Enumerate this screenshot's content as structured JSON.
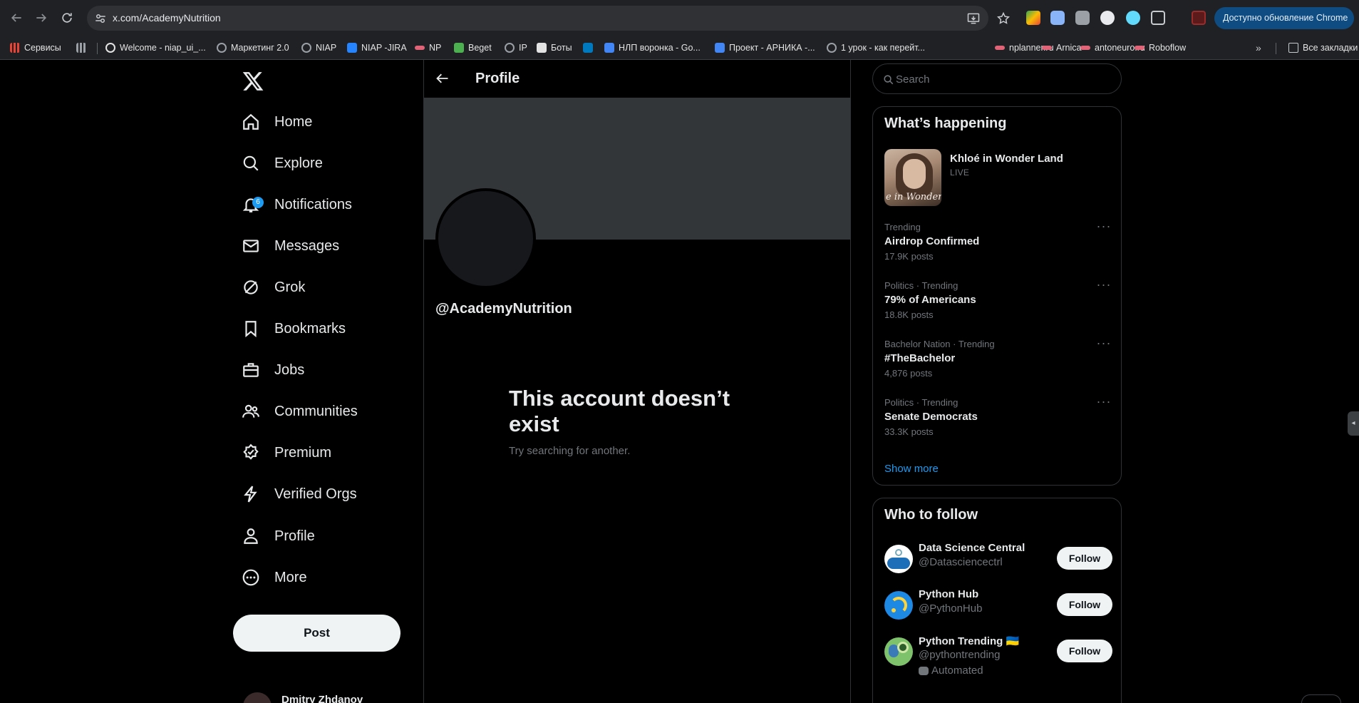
{
  "browser": {
    "url": "x.com/AcademyNutrition",
    "update_label": "Доступно обновление Chrome",
    "bookmarks": [
      {
        "label": "Сервисы",
        "icon": "apps-grid-icon",
        "color": "#ea4335"
      },
      {
        "label": "",
        "icon": "grid-icon",
        "color": "#9aa0a6"
      },
      {
        "label": "Welcome - niap_ui_...",
        "icon": "github-icon",
        "color": "#e3e3e3"
      },
      {
        "label": "Маркетинг 2.0",
        "icon": "globe-icon",
        "color": "#9aa0a6"
      },
      {
        "label": "NIAP",
        "icon": "globe-icon",
        "color": "#9aa0a6"
      },
      {
        "label": "NIAP -JIRA",
        "icon": "jira-icon",
        "color": "#2684ff"
      },
      {
        "label": "NP",
        "icon": "node-icon",
        "color": "#e06377"
      },
      {
        "label": "Beget",
        "icon": "beget-icon",
        "color": "#4caf50"
      },
      {
        "label": "IP",
        "icon": "globe-icon",
        "color": "#9aa0a6"
      },
      {
        "label": "Боты",
        "icon": "bots-icon",
        "color": "#e3e3e3"
      },
      {
        "label": "",
        "icon": "trello-icon",
        "color": "#0079bf"
      },
      {
        "label": "НЛП воронка - Go...",
        "icon": "docs-icon",
        "color": "#4285f4"
      },
      {
        "label": "Проект - АРНИКА -...",
        "icon": "docs-icon",
        "color": "#4285f4"
      },
      {
        "label": "1 урок - как перейт...",
        "icon": "globe-icon",
        "color": "#9aa0a6"
      },
      {
        "label": "nplanner.ru",
        "icon": "node-icon",
        "color": "#e06377"
      },
      {
        "label": "Arnica",
        "icon": "node-icon",
        "color": "#e06377"
      },
      {
        "label": "antoneuro.ru",
        "icon": "node-icon",
        "color": "#e06377"
      },
      {
        "label": "Roboflow",
        "icon": "node-icon",
        "color": "#e06377"
      }
    ],
    "all_bookmarks_label": "Все закладки"
  },
  "nav": {
    "items": [
      {
        "label": "Home",
        "icon": "home-icon"
      },
      {
        "label": "Explore",
        "icon": "search-icon"
      },
      {
        "label": "Notifications",
        "icon": "bell-icon",
        "badge": "6"
      },
      {
        "label": "Messages",
        "icon": "mail-icon"
      },
      {
        "label": "Grok",
        "icon": "grok-icon"
      },
      {
        "label": "Bookmarks",
        "icon": "bookmark-icon"
      },
      {
        "label": "Jobs",
        "icon": "briefcase-icon"
      },
      {
        "label": "Communities",
        "icon": "people-icon"
      },
      {
        "label": "Premium",
        "icon": "verified-icon"
      },
      {
        "label": "Verified Orgs",
        "icon": "lightning-icon"
      },
      {
        "label": "Profile",
        "icon": "person-icon"
      },
      {
        "label": "More",
        "icon": "more-circle-icon"
      }
    ],
    "post_label": "Post",
    "user_name_partial": "Dmitry Zhdanov"
  },
  "main": {
    "title": "Profile",
    "handle": "@AcademyNutrition",
    "empty_title": "This account doesn’t exist",
    "empty_sub": "Try searching for another."
  },
  "right": {
    "search_placeholder": "Search",
    "happening_title": "What’s happening",
    "live": {
      "title": "Khloé in Wonder Land",
      "tag": "LIVE",
      "thumb_text": "e in Wonder L"
    },
    "trends": [
      {
        "context": "Trending",
        "topic": "Airdrop Confirmed",
        "count": "17.9K posts"
      },
      {
        "context": "Politics · Trending",
        "topic": "79% of Americans",
        "count": "18.8K posts"
      },
      {
        "context": "Bachelor Nation · Trending",
        "topic": "#TheBachelor",
        "count": "4,876 posts"
      },
      {
        "context": "Politics · Trending",
        "topic": "Senate Democrats",
        "count": "33.3K posts"
      }
    ],
    "show_more": "Show more",
    "who_title": "Who to follow",
    "follow": [
      {
        "name": "Data Science Central",
        "handle": "@Datasciencectrl",
        "button": "Follow"
      },
      {
        "name": "Python Hub",
        "handle": "@PythonHub",
        "button": "Follow"
      },
      {
        "name": "Python Trending 🇺🇦",
        "handle": "@pythontrending",
        "extra": "Automated",
        "button": "Follow"
      }
    ]
  },
  "colors": {
    "accent": "#1d9bf0",
    "background": "#000000",
    "chrome": "#202124"
  }
}
